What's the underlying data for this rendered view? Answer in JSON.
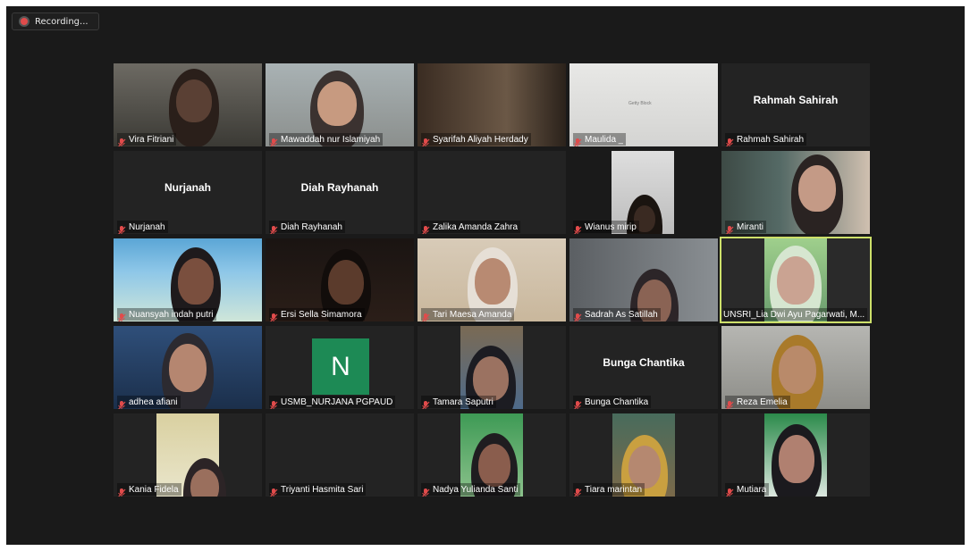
{
  "recording": {
    "label": "Recording..."
  },
  "participants": [
    {
      "name": "Vira Fitriani",
      "video": true
    },
    {
      "name": "Mawaddah nur Islamiyah",
      "video": true
    },
    {
      "name": "Syarifah Aliyah Herdady",
      "video": true
    },
    {
      "name": "Maulida _",
      "video": true,
      "background_text": "Getty Block"
    },
    {
      "name": "Rahmah Sahirah",
      "video": false,
      "display_name": "Rahmah Sahirah"
    },
    {
      "name": "Nurjanah",
      "video": false,
      "display_name": "Nurjanah"
    },
    {
      "name": "Diah Rayhanah",
      "video": false,
      "display_name": "Diah Rayhanah"
    },
    {
      "name": "Zalika Amanda Zahra",
      "video": false
    },
    {
      "name": "Wianus mirip",
      "video": true
    },
    {
      "name": "Miranti",
      "video": true
    },
    {
      "name": "Nuansyah indah putri",
      "video": true
    },
    {
      "name": "Ersi Sella Simamora",
      "video": true
    },
    {
      "name": "Tari Maesa Amanda",
      "video": true
    },
    {
      "name": "Sadrah As Satillah",
      "video": true
    },
    {
      "name": "UNSRI_Lia Dwi Ayu Pagarwati, M...",
      "video": true,
      "active_speaker": true
    },
    {
      "name": "adhea afiani",
      "video": true
    },
    {
      "name": "USMB_NURJANA PGPAUD",
      "video": false,
      "avatar_letter": "N",
      "avatar_color": "#1d8a55"
    },
    {
      "name": "Tamara Saputri",
      "video": true
    },
    {
      "name": "Bunga Chantika",
      "video": false,
      "display_name": "Bunga Chantika"
    },
    {
      "name": "Reza Emelia",
      "video": true
    },
    {
      "name": "Kania Fidela",
      "video": true
    },
    {
      "name": "Triyanti Hasmita Sari",
      "video": false
    },
    {
      "name": "Nadya Yulianda Santi",
      "video": true
    },
    {
      "name": "Tiara marintan",
      "video": true
    },
    {
      "name": "Mutiara",
      "video": true
    }
  ],
  "colors": {
    "background": "#1a1a1a",
    "tile": "#232323",
    "muted_mic": "#e04b4b",
    "active_border": "#cde06a"
  },
  "icons": {
    "mute": "mic-muted-icon",
    "record": "record-dot-icon"
  }
}
